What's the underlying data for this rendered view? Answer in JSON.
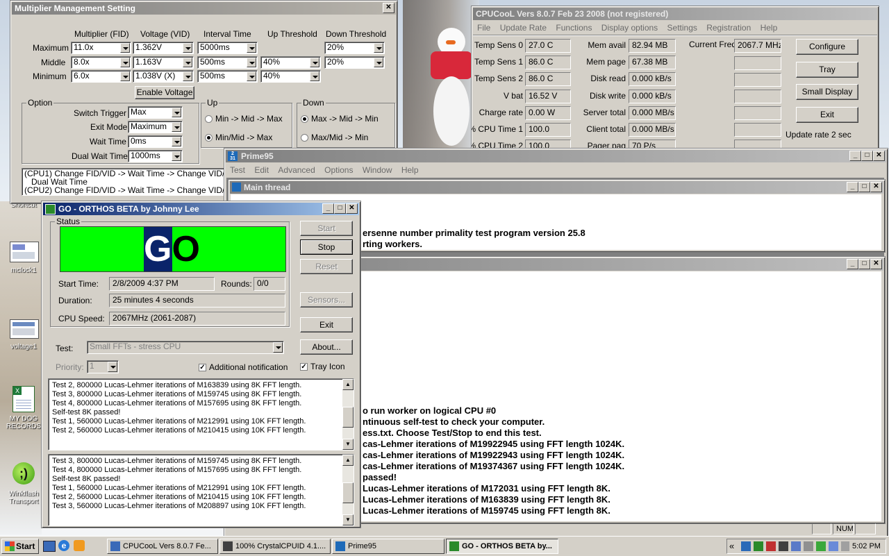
{
  "desktop": {
    "icons": [
      {
        "label": "Shortcut",
        "icon": "shortcut-icon"
      },
      {
        "label": "mclock1",
        "icon": "image-file-icon"
      },
      {
        "label": "voltage1",
        "icon": "image-file-icon"
      },
      {
        "label": "MY DOG RECORDS",
        "icon": "excel-file-icon"
      },
      {
        "label": "Winkflash Transport",
        "icon": "winkflash-icon"
      }
    ]
  },
  "mms": {
    "title": "Multiplier Management Setting",
    "headers": {
      "mult": "Multiplier (FID)",
      "volt": "Voltage (VID)",
      "interval": "Interval Time",
      "up": "Up Threshold",
      "down": "Down Threshold"
    },
    "rows": [
      {
        "label": "Maximum",
        "mult": "11.0x",
        "volt": "1.362V",
        "interval": "5000ms",
        "up": "",
        "down": "20%"
      },
      {
        "label": "Middle",
        "mult": "8.0x",
        "volt": "1.163V",
        "interval": "500ms",
        "up": "40%",
        "down": "20%"
      },
      {
        "label": "Minimum",
        "mult": "6.0x",
        "volt": "1.038V (X)",
        "interval": "500ms",
        "up": "40%",
        "down": ""
      }
    ],
    "enable_voltage": "Enable Voltage",
    "option_title": "Option",
    "options": [
      {
        "label": "Switch Trigger",
        "value": "Max"
      },
      {
        "label": "Exit Mode",
        "value": "Maximum"
      },
      {
        "label": "Wait Time",
        "value": "0ms"
      },
      {
        "label": "Dual Wait Time",
        "value": "1000ms"
      }
    ],
    "up_title": "Up",
    "up_options": [
      "Min -> Mid -> Max",
      "Min/Mid -> Max"
    ],
    "down_title": "Down",
    "down_options": [
      "Max -> Mid -> Min",
      "Max/Mid -> Min"
    ],
    "notes": [
      "(CPU1) Change FID/VID -> Wait Time -> Change VID/",
      "Dual Wait Time",
      "(CPU2) Change FID/VID -> Wait Time -> Change VID/"
    ]
  },
  "cpucool": {
    "title": "CPUCooL  Vers 8.0.7  Feb 23 2008 (not registered)",
    "menu": [
      "File",
      "Update Rate",
      "Functions",
      "Display options",
      "Settings",
      "Registration",
      "Help"
    ],
    "col1": [
      {
        "label": "Temp Sens 0",
        "value": "27.0 C"
      },
      {
        "label": "Temp Sens 1",
        "value": "86.0 C"
      },
      {
        "label": "Temp Sens 2",
        "value": "86.0 C"
      },
      {
        "label": "V bat",
        "value": "16.52 V"
      },
      {
        "label": "Charge rate",
        "value": "0.00 W"
      },
      {
        "label": "% CPU Time 1",
        "value": "100.0"
      },
      {
        "label": "% CPU Time 2",
        "value": "100.0"
      }
    ],
    "col2": [
      {
        "label": "Mem avail",
        "value": "82.94 MB"
      },
      {
        "label": "Mem page",
        "value": "67.38 MB"
      },
      {
        "label": "Disk read",
        "value": "0.000 kB/s"
      },
      {
        "label": "Disk write",
        "value": "0.000 kB/s"
      },
      {
        "label": "Server total",
        "value": "0.000 MB/s"
      },
      {
        "label": "Client total",
        "value": "0.000 MB/s"
      },
      {
        "label": "Pager pag",
        "value": "70 P/s"
      }
    ],
    "freq_label": "Current Freq",
    "freq_value": "2067.7 MHz",
    "buttons": [
      "Configure",
      "Tray",
      "Small Display",
      "Exit"
    ],
    "update_rate": "Update rate 2 sec"
  },
  "prime95": {
    "title": "Prime95",
    "menu": [
      "Test",
      "Edit",
      "Advanced",
      "Options",
      "Window",
      "Help"
    ],
    "main_thread_title": "Main thread",
    "main_lines": [
      "ersenne number primality test program version 25.8",
      "rting workers."
    ],
    "worker_lines": [
      "o run worker on logical CPU #0",
      "ntinuous self-test to check your computer.",
      "ess.txt.  Choose Test/Stop to end this test.",
      "cas-Lehmer iterations of M19922945 using FFT length 1024K.",
      "cas-Lehmer iterations of M19922943 using FFT length 1024K.",
      "cas-Lehmer iterations of M19374367 using FFT length 1024K.",
      "passed!",
      "Lucas-Lehmer iterations of M172031 using FFT length 8K.",
      "Lucas-Lehmer iterations of M163839 using FFT length 8K.",
      "Lucas-Lehmer iterations of M159745 using FFT length 8K."
    ],
    "status_num": "NUM"
  },
  "orthos": {
    "title": "GO - ORTHOS BETA by Johnny Lee",
    "status_label": "Status",
    "go_text": "GO",
    "start_time_label": "Start Time:",
    "start_time": "2/8/2009 4:37 PM",
    "rounds_label": "Rounds:",
    "rounds": "0/0",
    "duration_label": "Duration:",
    "duration": "25 minutes 4 seconds",
    "cpu_speed_label": "CPU Speed:",
    "cpu_speed": "2067MHz (2061-2087)",
    "buttons": {
      "start": "Start",
      "stop": "Stop",
      "reset": "Reset",
      "sensors": "Sensors...",
      "exit": "Exit",
      "about": "About..."
    },
    "test_label": "Test:",
    "test_value": "Small FFTs - stress CPU",
    "priority_label": "Priority:",
    "priority_value": "1",
    "additional_notification": "Additional notification",
    "tray_icon": "Tray Icon",
    "log1": [
      "Test 2, 800000 Lucas-Lehmer iterations of M163839 using 8K FFT length.",
      "Test 3, 800000 Lucas-Lehmer iterations of M159745 using 8K FFT length.",
      "Test 4, 800000 Lucas-Lehmer iterations of M157695 using 8K FFT length.",
      "Self-test 8K passed!",
      "Test 1, 560000 Lucas-Lehmer iterations of M212991 using 10K FFT length.",
      "Test 2, 560000 Lucas-Lehmer iterations of M210415 using 10K FFT length."
    ],
    "log2": [
      "Test 3, 800000 Lucas-Lehmer iterations of M159745 using 8K FFT length.",
      "Test 4, 800000 Lucas-Lehmer iterations of M157695 using 8K FFT length.",
      "Self-test 8K passed!",
      "Test 1, 560000 Lucas-Lehmer iterations of M212991 using 10K FFT length.",
      "Test 2, 560000 Lucas-Lehmer iterations of M210415 using 10K FFT length.",
      "Test 3, 560000 Lucas-Lehmer iterations of M208897 using 10K FFT length."
    ]
  },
  "taskbar": {
    "start": "Start",
    "tasks": [
      {
        "label": "CPUCooL  Vers 8.0.7  Fe...",
        "active": false
      },
      {
        "label": "100% CrystalCPUID 4.1....",
        "active": false
      },
      {
        "label": "Prime95",
        "active": false
      },
      {
        "label": "GO - ORTHOS BETA by...",
        "active": true
      }
    ],
    "tray_expand": "«",
    "clock": "5:02 PM"
  },
  "colors": {
    "go_green": "#00ff00",
    "go_navy": "#0a246a",
    "title_active": "#0a246a"
  }
}
